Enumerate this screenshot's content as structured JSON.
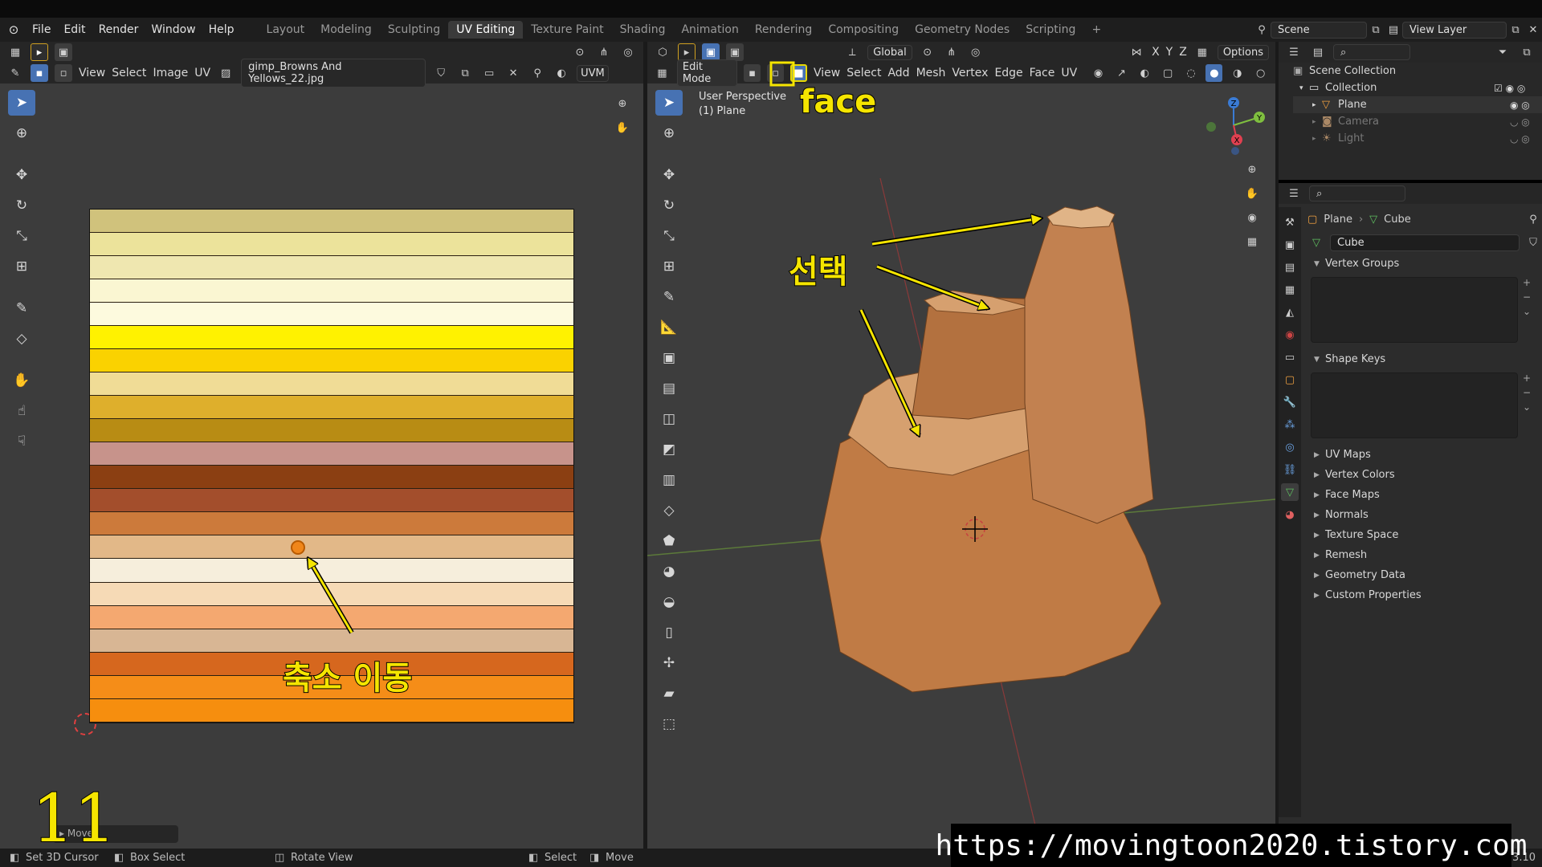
{
  "menubar": {
    "items": [
      "File",
      "Edit",
      "Render",
      "Window",
      "Help"
    ],
    "workspaces": [
      "Layout",
      "Modeling",
      "Sculpting",
      "UV Editing",
      "Texture Paint",
      "Shading",
      "Animation",
      "Rendering",
      "Compositing",
      "Geometry Nodes",
      "Scripting"
    ],
    "active_workspace": "UV Editing",
    "scene": "Scene",
    "view_layer": "View Layer"
  },
  "uv_editor": {
    "menus": [
      "View",
      "Select",
      "Image",
      "UV"
    ],
    "image_name": "gimp_Browns And Yellows_22.jpg",
    "uvm_label": "UVM",
    "stripes": [
      "#d0c27c",
      "#ece39b",
      "#efe7b0",
      "#faf6d2",
      "#fdfade",
      "#fff200",
      "#fad200",
      "#f0dc96",
      "#deaf2c",
      "#b88c14",
      "#c7938b",
      "#8b3f12",
      "#a34e2c",
      "#cc7a3b",
      "#e2b888",
      "#f6eedc",
      "#f6dab6",
      "#f4a870",
      "#d8b694",
      "#d6671e",
      "#f58d18",
      "#f68e0e"
    ],
    "operator_panel_label": "Move",
    "icon_colors": {
      "selected": "#4772b3",
      "uv_vertex": "#f0861a"
    }
  },
  "viewport": {
    "mode": "Edit Mode",
    "menus": [
      "View",
      "Select",
      "Add",
      "Mesh",
      "Vertex",
      "Edge",
      "Face",
      "UV"
    ],
    "transform_orientation": "Global",
    "axis_labels": [
      "X",
      "Y",
      "Z"
    ],
    "options_label": "Options",
    "perspective": "User Perspective",
    "object": "(1) Plane",
    "gizmo_axes": [
      "X",
      "Y",
      "Z"
    ]
  },
  "outliner": {
    "root": "Scene Collection",
    "collection": "Collection",
    "objects": [
      "Plane",
      "Camera",
      "Light"
    ]
  },
  "properties": {
    "breadcrumb_object": "Plane",
    "breadcrumb_mesh": "Cube",
    "mesh_name": "Cube",
    "sections_open": [
      "Vertex Groups",
      "Shape Keys"
    ],
    "sections_closed": [
      "UV Maps",
      "Vertex Colors",
      "Face Maps",
      "Normals",
      "Texture Space",
      "Remesh",
      "Geometry Data",
      "Custom Properties"
    ]
  },
  "statusbar": {
    "items": [
      "Set 3D Cursor",
      "Box Select",
      "Rotate View",
      "Select",
      "Move"
    ],
    "version": "3.10"
  },
  "annotations": {
    "face": "face",
    "select": "선택",
    "scale_move": "축소 이동",
    "step_number": "11",
    "url": "https://movingtoon2020.tistory.com"
  }
}
